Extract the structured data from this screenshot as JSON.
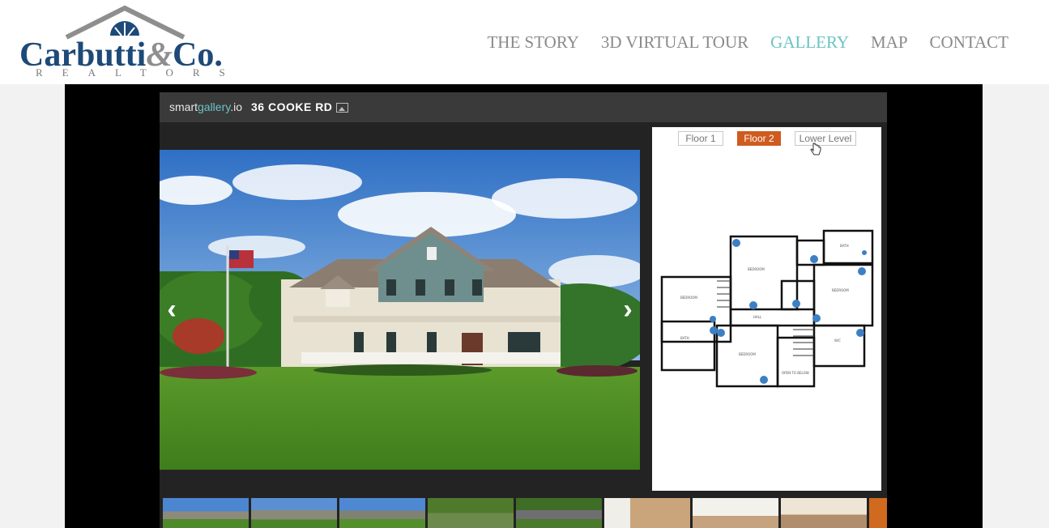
{
  "logo": {
    "name": "Carbutti",
    "amp": "&",
    "co": "Co.",
    "sub": "REALTORS"
  },
  "nav": [
    {
      "label": "THE STORY",
      "active": false
    },
    {
      "label": "3D VIRTUAL TOUR",
      "active": false
    },
    {
      "label": "GALLERY",
      "active": true
    },
    {
      "label": "MAP",
      "active": false
    },
    {
      "label": "CONTACT",
      "active": false
    }
  ],
  "gallery": {
    "brand_a": "smart",
    "brand_b": "gallery",
    "brand_c": ".io",
    "address": "36 COOKE RD",
    "prev_icon": "chevron-left-icon",
    "next_icon": "chevron-right-icon"
  },
  "floorplan": {
    "floors": [
      "Floor 1",
      "Floor 2",
      "Lower Level"
    ],
    "selected": "Floor 2"
  },
  "colors": {
    "accent": "#6cc3c4",
    "brand_navy": "#1d4a78",
    "floor_active": "#cf5b1f"
  }
}
